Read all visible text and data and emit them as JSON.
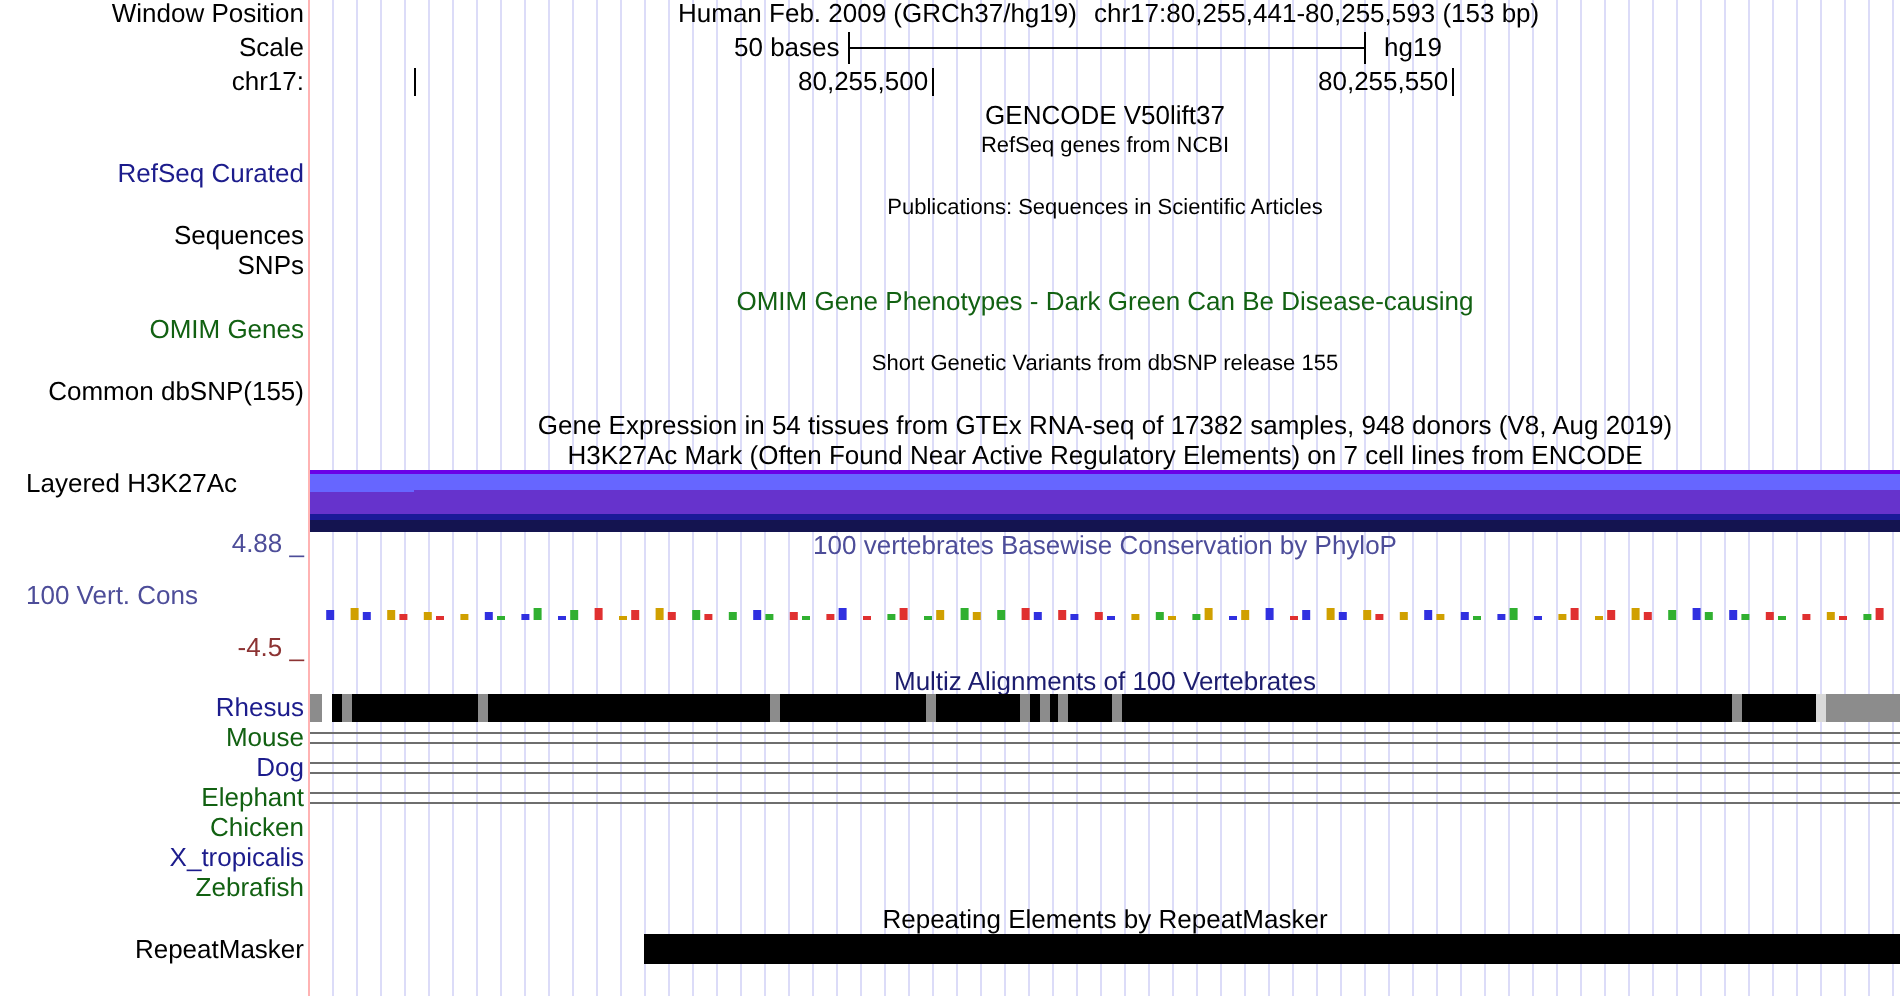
{
  "header": {
    "assembly": "Human Feb. 2009 (GRCh37/hg19)",
    "position": "chr17:80,255,441-80,255,593 (153 bp)"
  },
  "scale": {
    "length": "50 bases",
    "assembly": "hg19"
  },
  "ruler": {
    "ticks": [
      "80,255,500",
      "80,255,550"
    ]
  },
  "labels": [
    {
      "text": "Window Position",
      "color": "#000000",
      "kind": "track"
    },
    {
      "text": "Scale",
      "color": "#000000",
      "kind": "track"
    },
    {
      "text": "chr17:",
      "color": "#000000",
      "kind": "track"
    },
    {
      "text": "RefSeq Curated",
      "color": "#1c1c8c",
      "kind": "track"
    },
    {
      "text": "Sequences",
      "color": "#000000",
      "kind": "track"
    },
    {
      "text": "SNPs",
      "color": "#000000",
      "kind": "track"
    },
    {
      "text": "OMIM Genes",
      "color": "#126112",
      "kind": "track"
    },
    {
      "text": "Common dbSNP(155)",
      "color": "#000000",
      "kind": "track"
    },
    {
      "text": "Layered H3K27Ac",
      "color": "#000000",
      "kind": "composite"
    },
    {
      "text": "4.88 _",
      "color": "#4d4d99",
      "kind": "track"
    },
    {
      "text": "100 Vert. Cons",
      "color": "#4d4d99",
      "kind": "composite"
    },
    {
      "text": "-4.5 _",
      "color": "#8c3333",
      "kind": "track"
    }
  ],
  "titles": [
    {
      "text": "GENCODE V50lift37",
      "kind": "heading",
      "color": "#000000"
    },
    {
      "text": "RefSeq genes from NCBI",
      "kind": "note",
      "color": "#000000"
    },
    {
      "text": "Publications: Sequences in Scientific Articles",
      "kind": "note",
      "color": "#000000"
    },
    {
      "text": "OMIM Gene Phenotypes - Dark Green Can Be Disease-causing",
      "kind": "heading",
      "color": "#126112"
    },
    {
      "text": "Short Genetic Variants from dbSNP release 155",
      "kind": "note",
      "color": "#000000"
    },
    {
      "text": "Gene Expression in 54 tissues from GTEx RNA-seq of 17382 samples, 948 donors (V8, Aug 2019)",
      "kind": "heading",
      "color": "#000000"
    },
    {
      "text": "H3K27Ac Mark (Often Found Near Active Regulatory Elements) on 7 cell lines from ENCODE",
      "kind": "heading",
      "color": "#000000"
    },
    {
      "text": "100 vertebrates Basewise Conservation by PhyloP",
      "kind": "heading",
      "color": "#4d4d99"
    },
    {
      "text": "Multiz Alignments of 100 Vertebrates",
      "kind": "heading",
      "color": "#1c1c6e"
    },
    {
      "text": "Repeating Elements by RepeatMasker",
      "kind": "heading",
      "color": "#000000"
    }
  ],
  "species": [
    {
      "name": "Rhesus",
      "color": "#1c1c8c",
      "kind": "blocks"
    },
    {
      "name": "Mouse",
      "color": "#126112",
      "kind": "lines"
    },
    {
      "name": "Dog",
      "color": "#1c1c8c",
      "kind": "lines"
    },
    {
      "name": "Elephant",
      "color": "#126112",
      "kind": "lines"
    },
    {
      "name": "Chicken",
      "color": "#126112",
      "kind": "none"
    },
    {
      "name": "X_tropicalis",
      "color": "#1c1c8c",
      "kind": "none"
    },
    {
      "name": "Zebrafish",
      "color": "#126112",
      "kind": "none"
    }
  ],
  "repeats": {
    "label": "RepeatMasker"
  }
}
